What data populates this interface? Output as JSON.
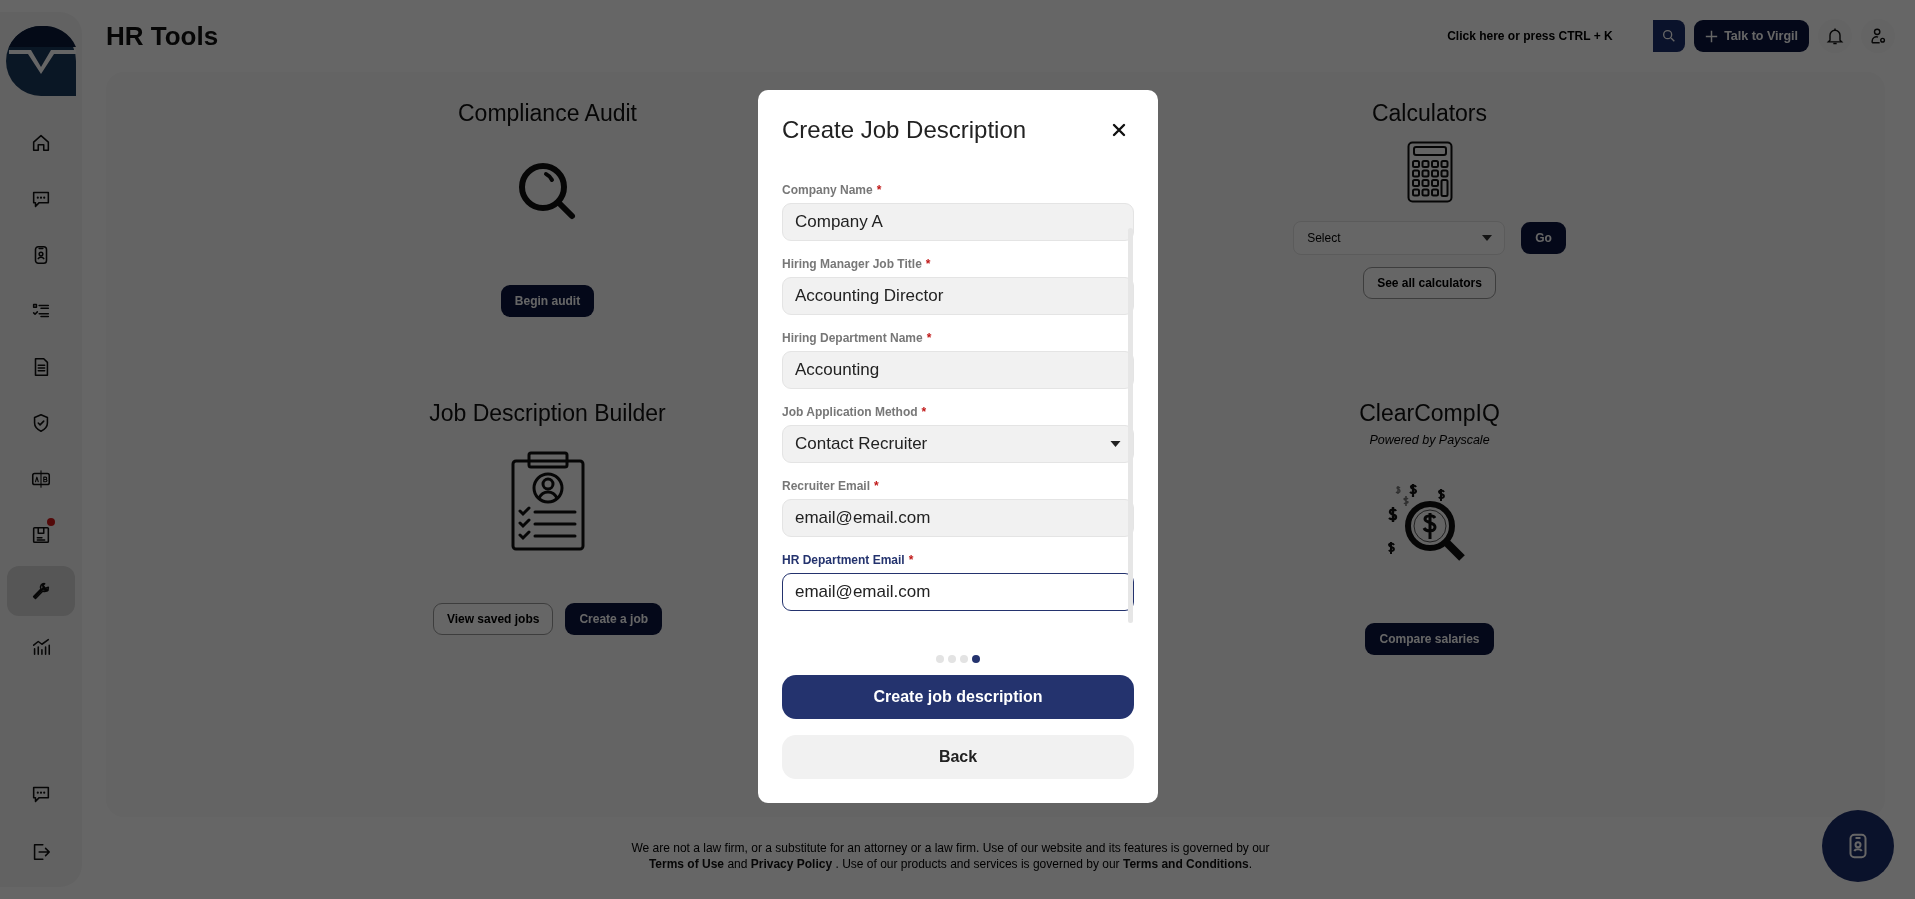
{
  "app": {
    "title": "HR Tools"
  },
  "sidebar": {
    "items": [
      {
        "kind": "home",
        "selected": false,
        "notification": false
      },
      {
        "kind": "chat",
        "selected": false,
        "notification": false
      },
      {
        "kind": "badge",
        "selected": false,
        "notification": false
      },
      {
        "kind": "checklist",
        "selected": false,
        "notification": false
      },
      {
        "kind": "document",
        "selected": false,
        "notification": false
      },
      {
        "kind": "shield",
        "selected": false,
        "notification": false
      },
      {
        "kind": "compare",
        "selected": false,
        "notification": false
      },
      {
        "kind": "save",
        "selected": false,
        "notification": true
      },
      {
        "kind": "wrench",
        "selected": true,
        "notification": false
      },
      {
        "kind": "chart",
        "selected": false,
        "notification": false
      }
    ],
    "bottom_items": [
      {
        "kind": "chat",
        "selected": false,
        "notification": false
      },
      {
        "kind": "logout",
        "selected": false,
        "notification": false
      }
    ]
  },
  "topbar": {
    "search": {
      "placeholder": "Click here or press CTRL + K"
    },
    "talk_button": "Talk to Virgil"
  },
  "cards": [
    {
      "kind": "audit",
      "title": "Compliance Audit",
      "buttons": [
        {
          "label": "Begin audit",
          "kind": "filled"
        }
      ]
    },
    {
      "kind": "calculators",
      "title": "Calculators",
      "select": {
        "placeholder": "Select"
      },
      "go_button": "Go",
      "buttons": [
        {
          "label": "See all calculators",
          "kind": "outline"
        }
      ]
    },
    {
      "kind": "jobs",
      "title": "Job Description Builder",
      "buttons": [
        {
          "label": "View saved jobs",
          "kind": "outline"
        },
        {
          "label": "Create a job",
          "kind": "filled"
        }
      ]
    },
    {
      "kind": "compiq",
      "title": "ClearCompIQ",
      "subtitle": "Powered by Payscale",
      "buttons": [
        {
          "label": "Compare salaries",
          "kind": "filled"
        }
      ]
    }
  ],
  "modal": {
    "title": "Create Job Description",
    "required_mark": "*",
    "fields": [
      {
        "label": "Company Name",
        "required": true,
        "kind": "text",
        "value": "Company A",
        "focused": false
      },
      {
        "label": "Hiring Manager Job Title",
        "required": true,
        "kind": "text",
        "value": "Accounting Director",
        "focused": false
      },
      {
        "label": "Hiring Department Name",
        "required": true,
        "kind": "text",
        "value": "Accounting",
        "focused": false
      },
      {
        "label": "Job Application Method",
        "required": true,
        "kind": "select",
        "value": "Contact Recruiter",
        "focused": false
      },
      {
        "label": "Recruiter Email",
        "required": true,
        "kind": "text",
        "value": "email@email.com",
        "focused": false
      },
      {
        "label": "HR Department Email",
        "required": true,
        "kind": "text",
        "value": "email@email.com",
        "focused": true
      }
    ],
    "steps": [
      {
        "selected": false
      },
      {
        "selected": false
      },
      {
        "selected": false
      },
      {
        "selected": true
      }
    ],
    "primary_button": "Create job description",
    "back_button": "Back"
  },
  "footer": {
    "lines": [
      [
        {
          "text": "We are not a law firm, or a substitute for an attorney or a law firm. Use of our website and its features is governed by our",
          "kind": "text"
        }
      ],
      [
        {
          "text": "Terms of Use",
          "kind": "link"
        },
        {
          "text": " and ",
          "kind": "text"
        },
        {
          "text": "Privacy Policy",
          "kind": "link"
        },
        {
          "text": " . Use of our products and services is governed by our ",
          "kind": "text"
        },
        {
          "text": "Terms and Conditions",
          "kind": "link"
        },
        {
          "text": ".",
          "kind": "text"
        }
      ]
    ]
  }
}
